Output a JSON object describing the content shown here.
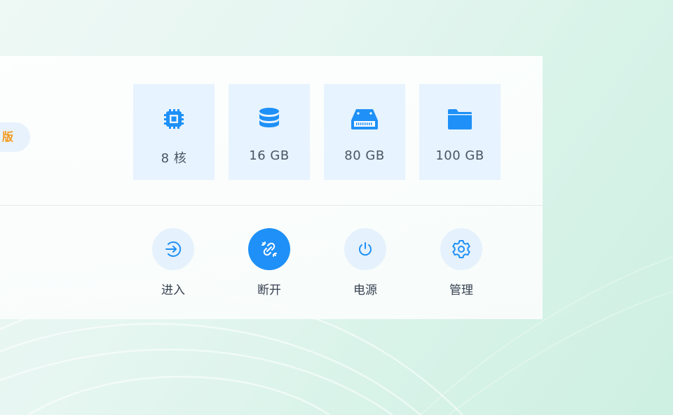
{
  "instance": {
    "edition_badge": "版"
  },
  "specs": {
    "cpu": {
      "icon": "cpu-chip-icon",
      "value": "8 核"
    },
    "memory": {
      "icon": "memory-database-icon",
      "value": "16 GB"
    },
    "system_disk": {
      "icon": "hard-drive-icon",
      "value": "80 GB"
    },
    "data_disk": {
      "icon": "folder-icon",
      "value": "100 GB"
    }
  },
  "actions": {
    "enter": {
      "icon": "enter-arrow-icon",
      "label": "进入"
    },
    "disconnect": {
      "icon": "unlink-icon",
      "label": "断开",
      "active": true
    },
    "power": {
      "icon": "power-icon",
      "label": "电源"
    },
    "manage": {
      "icon": "gear-icon",
      "label": "管理"
    }
  },
  "colors": {
    "accent": "#1e90f7",
    "tile_bg": "#e7f3fe",
    "badge_text": "#f29a1a"
  }
}
